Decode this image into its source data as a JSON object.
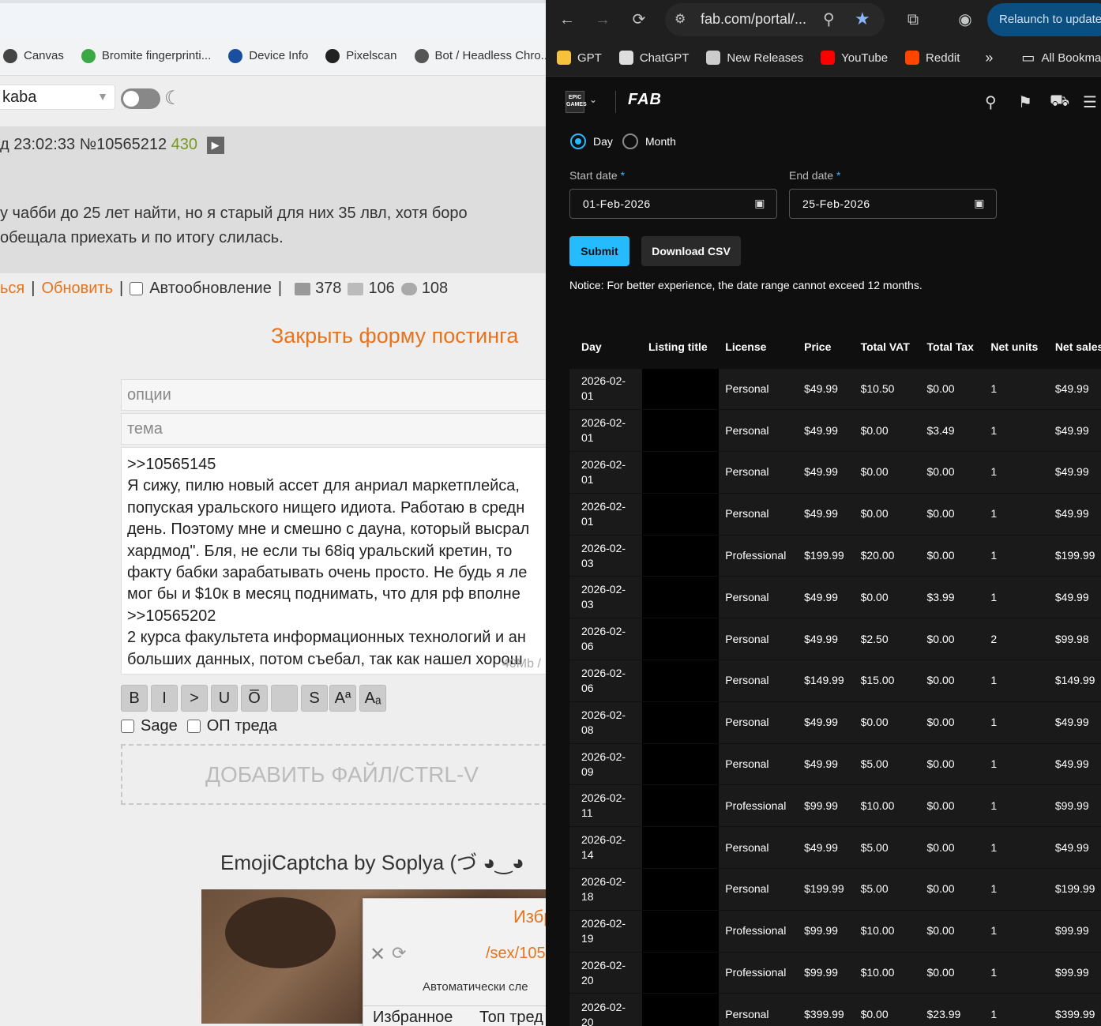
{
  "left": {
    "bookmarks": [
      {
        "label": "Canvas",
        "icon": "fingerprint-icon",
        "color": "#444"
      },
      {
        "label": "Bromite fingerprinti...",
        "icon": "bromite-icon",
        "color": "#3aa845"
      },
      {
        "label": "Device Info",
        "icon": "di-icon",
        "color": "#1a4fa0"
      },
      {
        "label": "Pixelscan",
        "icon": "pixelscan-icon",
        "color": "#222"
      },
      {
        "label": "Bot / Headless Chro...",
        "icon": "globe-icon",
        "color": "#555"
      }
    ],
    "board_select": "kaba",
    "post_meta": {
      "time": "д 23:02:33",
      "number": "№10565212",
      "replies": "430"
    },
    "post_text": [
      "у чабби до 25 лет найти, но я старый для них 35 лвл, хотя боро",
      "обещала приехать и по итогу слилась."
    ],
    "nav": {
      "back": "ься",
      "refresh": "Обновить",
      "auto": "Автообновление",
      "posts": "378",
      "images": "106",
      "users": "108"
    },
    "close_form": "Закрыть форму постинга",
    "options_placeholder": "опции",
    "subject_placeholder": "тема",
    "message": ">>10565145\nЯ сижу, пилю новый ассет для анриал маркетплейса,\nпопуская уральского нищего идиота. Работаю в средн\nдень. Поэтому мне и смешно с дауна, который высрал\nхардмод\". Бля, не если ты 68iq уральский кретин, то\nфакту бабки зарабатывать очень просто. Не будь я ле\nмог бы и $10к в месяц поднимать, что для рф вполне\n>>10565202\n2 курса факультета информационных технологий и ан\nбольших данных, потом съебал, так как нашел хорош",
    "counter": "40Mb /",
    "toolbar": [
      "B",
      "I",
      ">",
      "U",
      "O̅",
      " ",
      "S",
      "Aª",
      "Aₐ"
    ],
    "sage": "Sage",
    "op": "ОП треда",
    "dropzone": "ДОБАВИТЬ ФАЙЛ/CTRL-V",
    "captcha": "EmojiCaptcha by Soplya (づ ◕‿◕",
    "popup": {
      "title": "Избр",
      "link": "/sex/105",
      "auto": "Автоматически сле",
      "tab1": "Избранное",
      "tab2": "Топ тред"
    }
  },
  "right": {
    "url": "fab.com/portal/...",
    "relaunch": "Relaunch to update",
    "bookmarks": [
      {
        "label": "GPT",
        "icon": "emoji-icon",
        "color": "#f6c23e"
      },
      {
        "label": "ChatGPT",
        "icon": "chatgpt-icon",
        "color": "#ddd"
      },
      {
        "label": "New Releases",
        "icon": "new-releases-icon",
        "color": "#ccc"
      },
      {
        "label": "YouTube",
        "icon": "youtube-icon",
        "color": "#ff0000"
      },
      {
        "label": "Reddit",
        "icon": "reddit-icon",
        "color": "#ff4500"
      }
    ],
    "more": "»",
    "all_bookmarks": "All Bookma",
    "radio_day": "Day",
    "radio_month": "Month",
    "start_label": "Start date",
    "end_label": "End date",
    "required": "*",
    "start_value": "01-Feb-2026",
    "end_value": "25-Feb-2026",
    "submit": "Submit",
    "download": "Download CSV",
    "notice": "Notice: For better experience, the date range cannot exceed 12 months.",
    "columns": [
      "Day",
      "Listing title",
      "License",
      "Price",
      "Total VAT",
      "Total Tax",
      "Net units",
      "Net sales"
    ],
    "rows": [
      [
        "2026-02-01",
        "Personal",
        "$49.99",
        "$10.50",
        "$0.00",
        "1",
        "$49.99"
      ],
      [
        "2026-02-01",
        "Personal",
        "$49.99",
        "$0.00",
        "$3.49",
        "1",
        "$49.99"
      ],
      [
        "2026-02-01",
        "Personal",
        "$49.99",
        "$0.00",
        "$0.00",
        "1",
        "$49.99"
      ],
      [
        "2026-02-01",
        "Personal",
        "$49.99",
        "$0.00",
        "$0.00",
        "1",
        "$49.99"
      ],
      [
        "2026-02-03",
        "Professional",
        "$199.99",
        "$20.00",
        "$0.00",
        "1",
        "$199.99"
      ],
      [
        "2026-02-03",
        "Personal",
        "$49.99",
        "$0.00",
        "$3.99",
        "1",
        "$49.99"
      ],
      [
        "2026-02-06",
        "Personal",
        "$49.99",
        "$2.50",
        "$0.00",
        "2",
        "$99.98"
      ],
      [
        "2026-02-06",
        "Personal",
        "$149.99",
        "$15.00",
        "$0.00",
        "1",
        "$149.99"
      ],
      [
        "2026-02-08",
        "Personal",
        "$49.99",
        "$0.00",
        "$0.00",
        "1",
        "$49.99"
      ],
      [
        "2026-02-09",
        "Personal",
        "$49.99",
        "$5.00",
        "$0.00",
        "1",
        "$49.99"
      ],
      [
        "2026-02-11",
        "Professional",
        "$99.99",
        "$10.00",
        "$0.00",
        "1",
        "$99.99"
      ],
      [
        "2026-02-14",
        "Personal",
        "$49.99",
        "$5.00",
        "$0.00",
        "1",
        "$49.99"
      ],
      [
        "2026-02-18",
        "Personal",
        "$199.99",
        "$5.00",
        "$0.00",
        "1",
        "$199.99"
      ],
      [
        "2026-02-19",
        "Professional",
        "$99.99",
        "$10.00",
        "$0.00",
        "1",
        "$99.99"
      ],
      [
        "2026-02-20",
        "Professional",
        "$99.99",
        "$10.00",
        "$0.00",
        "1",
        "$99.99"
      ],
      [
        "2026-02-20",
        "Personal",
        "$399.99",
        "$0.00",
        "$23.99",
        "1",
        "$399.99"
      ]
    ]
  }
}
